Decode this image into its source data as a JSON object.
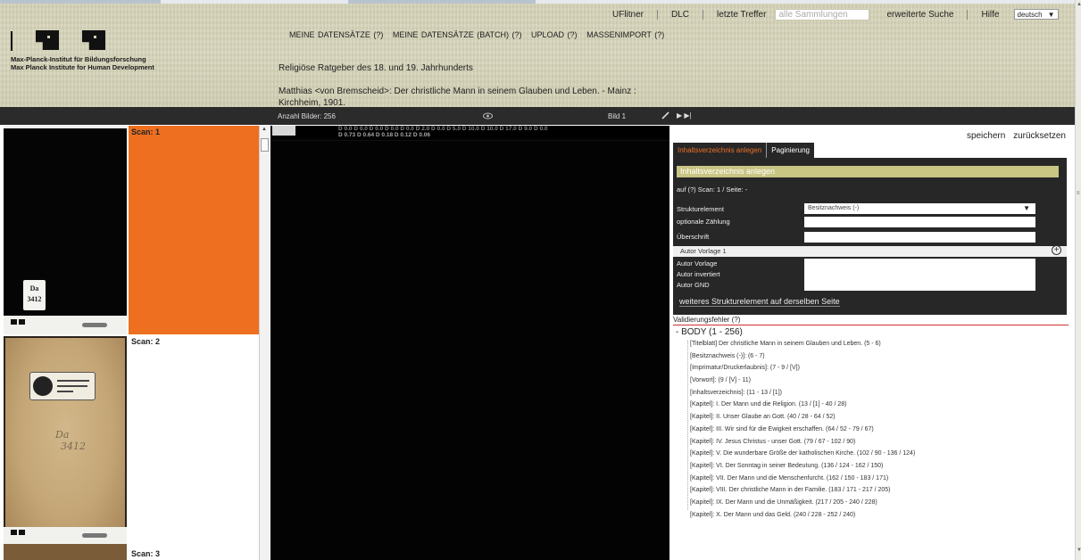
{
  "header": {
    "institute_de": "Max-Planck-Institut für Bildungsforschung",
    "institute_en": "Max Planck Institute for Human Development",
    "user": "UFlitner",
    "dlc": "DLC",
    "recent": "letzte Treffer",
    "search_placeholder": "alle Sammlungen",
    "advanced_search": "erweiterte Suche",
    "help": "Hilfe",
    "language": "deutsch",
    "menu": [
      "MEINE DATENSÄTZE (?)",
      "MEINE DATENSÄTZE (BATCH) (?)",
      "UPLOAD (?)",
      "MASSENIMPORT (?)"
    ],
    "collection": "Religiöse Ratgeber des 18. und 19. Jahrhunderts",
    "record_title": "Matthias <von Bremscheid>: Der christliche Mann in seinem Glauben und Leben. - Mainz : Kirchheim, 1901."
  },
  "toolbar": {
    "image_count": "Anzahl Bilder: 256",
    "current_image": "Bild 1",
    "nav": "▶ ▶|"
  },
  "thumbs": {
    "scan1": "Scan: 1",
    "scan2": "Scan: 2",
    "scan3": "Scan: 3",
    "label1_top": "Da",
    "label1_bottom": "3412",
    "hand_note_1": "Da",
    "hand_note_2": "3412"
  },
  "viewer": {
    "density_top": "D 0.0   D 0.0   D 0.0   D 0.0   D 0.0   D 2.0   D 0.0   D 5.0  D 10.0  D 10.0  D 17.0  D 9.0  D 0.0",
    "density_bottom": "D 0.73  D 0.64  D 0.18  D 0.12  D 0.06"
  },
  "panel": {
    "save": "speichern",
    "reset": "zurücksetzen",
    "tab_toc": "Inhaltsverzeichnis anlegen",
    "tab_pagination": "Paginierung",
    "form_heading": "Inhaltsverzeichnis anlegen",
    "scan_info": "auf (?) Scan: 1 / Seite: -",
    "struct_label": "Strukturelement",
    "struct_value": "Besitznachweis (-)",
    "optional_label": "optionale Zählung",
    "heading_label": "Überschrift",
    "author_template": "Autor Vorlage 1",
    "author_label": "Autor Vorlage",
    "author_inverted_label": "Autor invertiert",
    "author_gnd_label": "Autor GND",
    "more_button": "weiteres Strukturelement auf derselben Seite",
    "validation": "Validierungsfehler (?)",
    "tree_root": "- BODY (1 - 256)",
    "tree": [
      "[Titelblatt] Der christliche Mann in seinem Glauben und Leben. (5 - 6)",
      "[Besitznachweis (-)]: (6 - 7)",
      "[Imprimatur/Druckerlaubnis]: (7 - 9 / [V])",
      "[Vorwort]: (9 / [V] - 11)",
      "[Inhaltsverzeichnis]: (11 - 13 / [1])",
      "[Kapitel]: I. Der Mann und die Religion. (13 / [1] - 40 / 28)",
      "[Kapitel]: II. Unser Glaube an Gott. (40 / 28 - 64 / 52)",
      "[Kapitel]: III. Wir sind für die Ewigkeit erschaffen. (64 / 52 - 79 / 67)",
      "[Kapitel]: IV. Jesus Christus - unser Gott. (79 / 67 - 102 / 90)",
      "[Kapitel]: V. Die wunderbare Größe der katholischen Kirche. (102 / 90 - 136 / 124)",
      "[Kapitel]: VI. Der Sonntag in seiner Bedeutung. (136 / 124 - 162 / 150)",
      "[Kapitel]: VII. Der Mann und die Menschenfurcht. (162 / 150 - 183 / 171)",
      "[Kapitel]: VIII. Der christliche Mann in der Familie. (183 / 171 - 217 / 205)",
      "[Kapitel]: IX. Der Mann und die Unmäßigkeit. (217 / 205 - 240 / 228)",
      "[Kapitel]: X. Der Mann und das Geld. (240 / 228 - 252 / 240)"
    ]
  },
  "colors": {
    "accent": "#ee6f1f",
    "panel": "#272727",
    "header": "#d5d3b7",
    "form_heading": "#c9c583"
  }
}
